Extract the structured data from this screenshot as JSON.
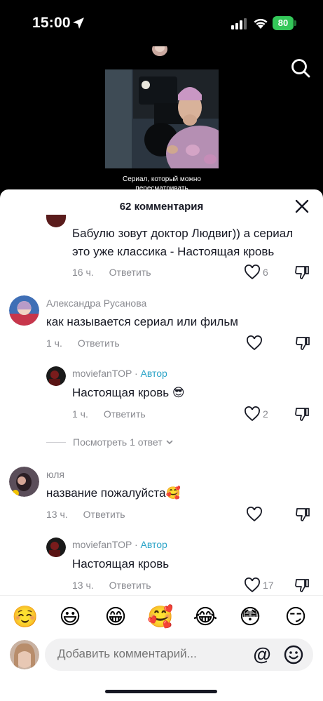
{
  "status_bar": {
    "time": "15:00",
    "battery": "80"
  },
  "video": {
    "caption": "Сериал, который можно пересматривать"
  },
  "sheet": {
    "title": "62 комментария"
  },
  "comments": [
    {
      "text_line1": "Бабулю зовут доктор Людвиг)) а сериал",
      "text_line2": "это уже классика - Настоящая кровь",
      "time": "16 ч.",
      "reply_label": "Ответить",
      "likes": "6"
    },
    {
      "author": "Александра Русанова",
      "text": "как называется сериал или фильм",
      "time": "1 ч.",
      "reply_label": "Ответить"
    },
    {
      "author": "moviefanTOP",
      "author_tag": "Автор",
      "text": "Настоящая кровь 😎",
      "time": "1 ч.",
      "reply_label": "Ответить",
      "likes": "2"
    },
    {
      "author": "юля",
      "text": "название пожалуйста🥰",
      "time": "13 ч.",
      "reply_label": "Ответить"
    },
    {
      "author": "moviefanTOP",
      "author_tag": "Автор",
      "text": "Настоящая кровь",
      "time": "13 ч.",
      "reply_label": "Ответить",
      "likes": "17"
    }
  ],
  "view_replies": "Посмотреть 1 ответ",
  "author_separator": " · ",
  "emojis": [
    "☺️",
    "😃",
    "😁",
    "🥰",
    "😂",
    "😳",
    "😏"
  ],
  "input": {
    "placeholder": "Добавить комментарий...",
    "at_symbol": "@"
  },
  "colors": {
    "accent_author_tag": "#2aa3c7",
    "battery": "#34c759",
    "text_primary": "#161823",
    "text_secondary": "#8a8b91"
  }
}
